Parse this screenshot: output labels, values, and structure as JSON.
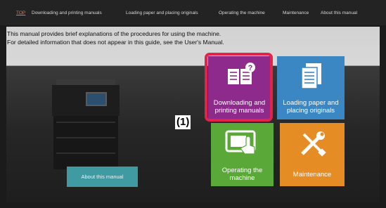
{
  "nav": [
    "TOP",
    "Downloading and printing manuals",
    "Loading paper and placing originals",
    "Operating the machine",
    "Maintenance",
    "About this manual"
  ],
  "intro": {
    "line1": "This manual provides brief explanations of the procedures for using the machine.",
    "line2": "For detailed information that does not appear in this guide, see the User's Manual."
  },
  "tiles": {
    "downloading": "Downloading and printing manuals",
    "loading": "Loading paper and placing originals",
    "operating": "Operating the machine",
    "maintenance": "Maintenance"
  },
  "about_button": "About this manual",
  "callout": "(1)",
  "colors": {
    "purple": "#8e2a8c",
    "blue": "#3b87c4",
    "green": "#5aa837",
    "orange": "#e68c25",
    "teal": "#3f9aa1",
    "highlight": "#e3234a"
  }
}
